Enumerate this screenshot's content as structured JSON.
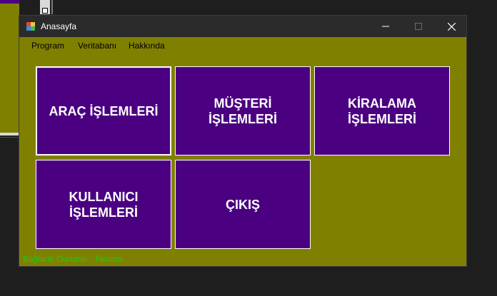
{
  "window": {
    "title": "Anasayfa"
  },
  "colors": {
    "form_bg": "#808000",
    "tile_bg": "#4b0082",
    "tile_text": "#ffffff",
    "status_text": "#1ec81e",
    "titlebar_bg": "#2b2b2b"
  },
  "titlebar": {
    "icons": {
      "minimize": "minimize-icon",
      "maximize": "maximize-icon",
      "close": "close-icon"
    }
  },
  "menu": [
    {
      "label": "Program"
    },
    {
      "label": "Veritabanı"
    },
    {
      "label": "Hakkında"
    }
  ],
  "tiles": [
    {
      "label": "ARAÇ İŞLEMLERİ"
    },
    {
      "label": "MÜŞTERİ\nİŞLEMLERİ"
    },
    {
      "label": "KİRALAMA\nİŞLEMLERİ"
    },
    {
      "label": "KULLANICI\nİŞLEMLERİ"
    },
    {
      "label": "ÇIKIŞ"
    }
  ],
  "status": {
    "text": "Bağlantı Durumu : Tamam"
  }
}
